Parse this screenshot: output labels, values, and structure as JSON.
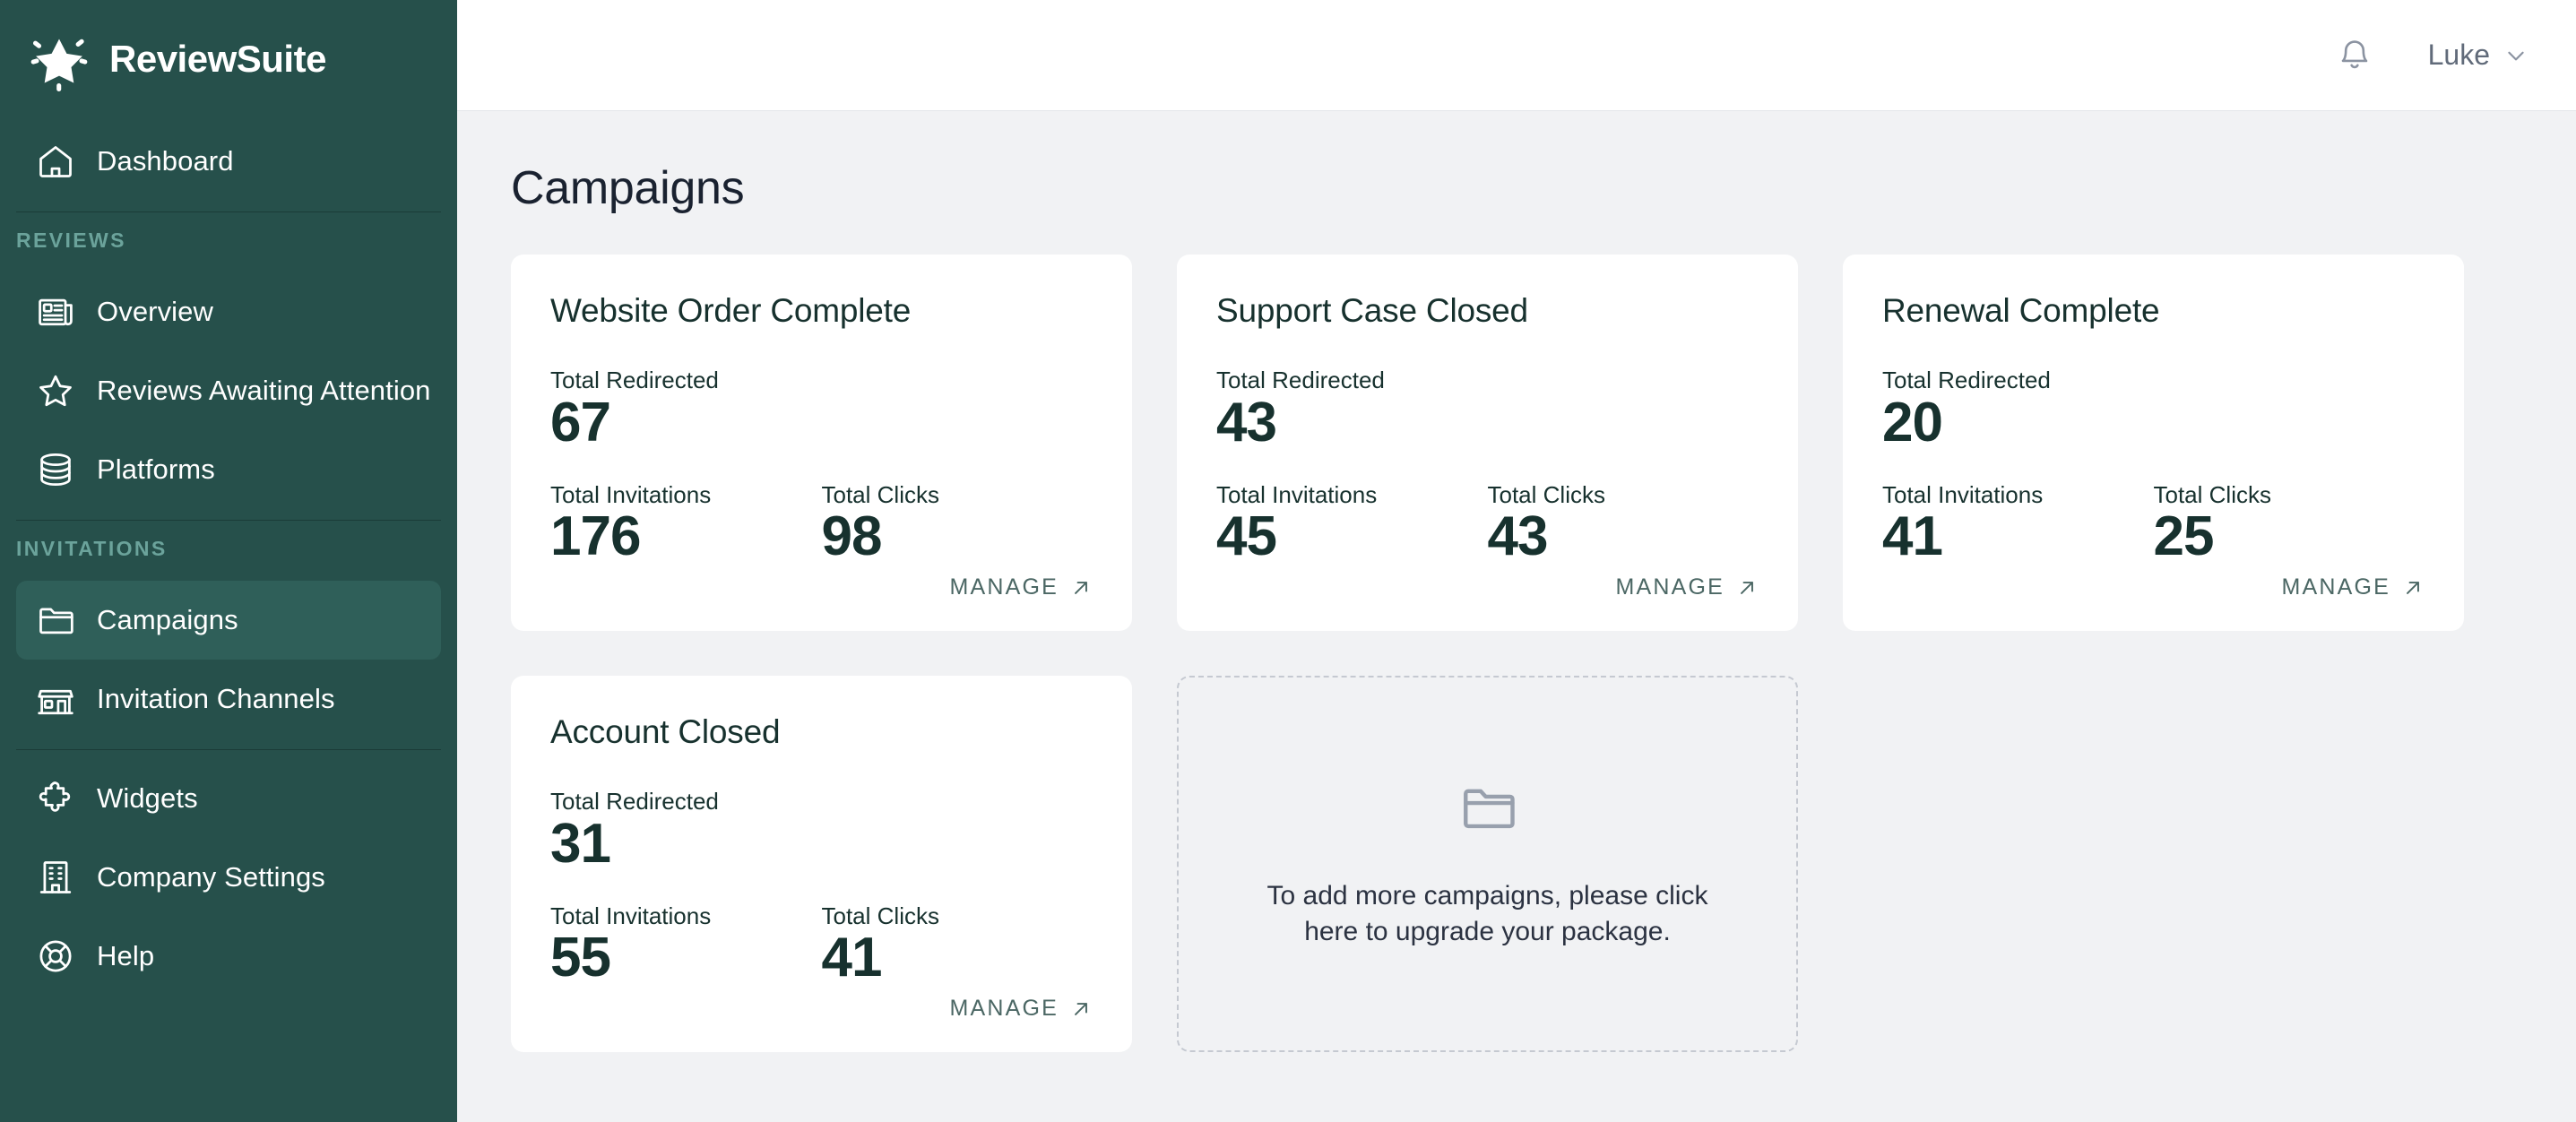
{
  "brand": {
    "name": "ReviewSuite",
    "logo_icon": "sparkle-star-icon"
  },
  "sidebar": {
    "dashboard": {
      "label": "Dashboard",
      "icon": "home-icon"
    },
    "sections": [
      {
        "heading": "REVIEWS",
        "items": [
          {
            "label": "Overview",
            "icon": "newspaper-icon"
          },
          {
            "label": "Reviews Awaiting Attention",
            "icon": "star-icon"
          },
          {
            "label": "Platforms",
            "icon": "database-icon"
          }
        ]
      },
      {
        "heading": "INVITATIONS",
        "items": [
          {
            "label": "Campaigns",
            "icon": "folder-icon",
            "active": true
          },
          {
            "label": "Invitation Channels",
            "icon": "storefront-icon"
          }
        ]
      }
    ],
    "footer_items": [
      {
        "label": "Widgets",
        "icon": "puzzle-icon"
      },
      {
        "label": "Company Settings",
        "icon": "building-icon"
      },
      {
        "label": "Help",
        "icon": "lifebuoy-icon"
      }
    ]
  },
  "topbar": {
    "notifications_icon": "bell-icon",
    "user_name": "Luke",
    "chevron_icon": "chevron-down-icon"
  },
  "page": {
    "title": "Campaigns",
    "labels": {
      "total_redirected": "Total Redirected",
      "total_invitations": "Total Invitations",
      "total_clicks": "Total Clicks",
      "manage": "MANAGE",
      "manage_icon": "arrow-up-right-icon"
    },
    "campaigns": [
      {
        "name": "Website Order Complete",
        "total_redirected": "67",
        "total_invitations": "176",
        "total_clicks": "98"
      },
      {
        "name": "Support Case Closed",
        "total_redirected": "43",
        "total_invitations": "45",
        "total_clicks": "43"
      },
      {
        "name": "Renewal Complete",
        "total_redirected": "20",
        "total_invitations": "41",
        "total_clicks": "25"
      },
      {
        "name": "Account Closed",
        "total_redirected": "31",
        "total_invitations": "55",
        "total_clicks": "41"
      }
    ],
    "upgrade_card": {
      "icon": "folder-icon",
      "text": "To add more campaigns, please click here to upgrade your package."
    }
  },
  "colors": {
    "sidebar_bg": "#26504b",
    "sidebar_active": "#2f5f59",
    "sidebar_heading": "#6ba39b",
    "main_bg": "#f1f2f4",
    "card_bg": "#ffffff",
    "text_dark": "#17312e",
    "title_dark": "#1a2230",
    "muted": "#616b7a",
    "manage": "#4b6764",
    "dashed_border": "#c5c9d1"
  }
}
